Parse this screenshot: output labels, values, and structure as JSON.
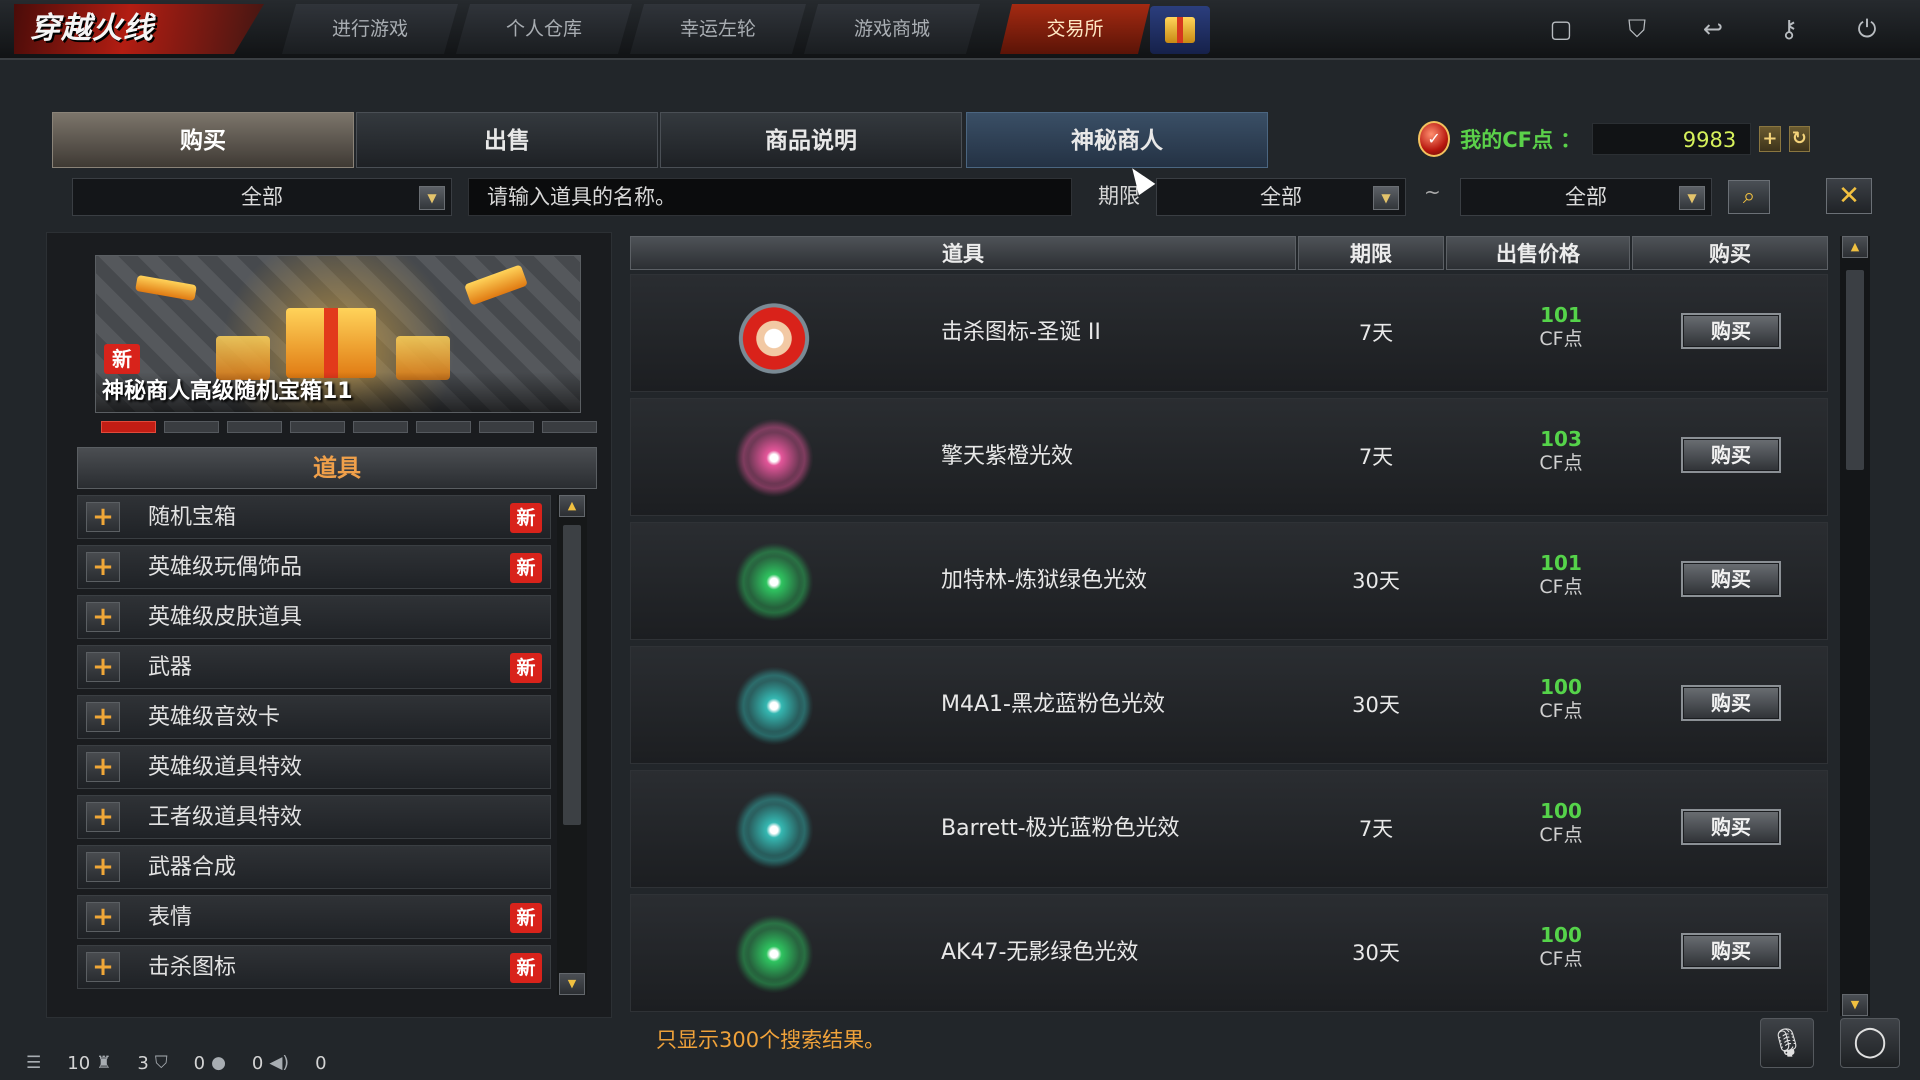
{
  "app": {
    "logo_text": "穿越火线"
  },
  "nav": {
    "items": [
      "进行游戏",
      "个人仓库",
      "幸运左轮",
      "游戏商城",
      "交易所"
    ],
    "active": "交易所",
    "icons": [
      "store-icon",
      "shield-icon",
      "return-icon",
      "key-icon",
      "power-icon"
    ]
  },
  "tabs": [
    "购买",
    "出售",
    "商品说明",
    "神秘商人"
  ],
  "cf": {
    "label": "我的CF点 ：",
    "value": "9983",
    "add": "+",
    "refresh": "↻"
  },
  "filters": {
    "category": "全部",
    "search_placeholder": "请输入道具的名称。",
    "period_label": "期限",
    "period_from": "全部",
    "tilde": "~",
    "period_to": "全部"
  },
  "banner": {
    "title": "神秘商人高级随机宝箱11",
    "new_badge": "新",
    "pages": 8,
    "active_page": 0
  },
  "left": {
    "header": "道具",
    "categories": [
      {
        "label": "随机宝箱",
        "new": "新"
      },
      {
        "label": "英雄级玩偶饰品",
        "new": "新"
      },
      {
        "label": "英雄级皮肤道具",
        "new": ""
      },
      {
        "label": "武器",
        "new": "新"
      },
      {
        "label": "英雄级音效卡",
        "new": ""
      },
      {
        "label": "英雄级道具特效",
        "new": ""
      },
      {
        "label": "王者级道具特效",
        "new": ""
      },
      {
        "label": "武器合成",
        "new": ""
      },
      {
        "label": "表情",
        "new": "新"
      },
      {
        "label": "击杀图标",
        "new": "新"
      }
    ]
  },
  "table": {
    "headers": [
      "道具",
      "期限",
      "出售价格",
      "购买"
    ],
    "rows": [
      {
        "name": "击杀图标-圣诞 II",
        "period": "7天",
        "price": "101",
        "unit": "CF点",
        "buy": "购买",
        "icon": "santa-icon"
      },
      {
        "name": "擎天紫橙光效",
        "period": "7天",
        "price": "103",
        "unit": "CF点",
        "buy": "购买",
        "icon": "purple-orange-glow-icon",
        "color": "#e4569a"
      },
      {
        "name": "加特林-炼狱绿色光效",
        "period": "30天",
        "price": "101",
        "unit": "CF点",
        "buy": "购买",
        "icon": "green-glow-icon",
        "color": "#2fc460"
      },
      {
        "name": "M4A1-黑龙蓝粉色光效",
        "period": "30天",
        "price": "100",
        "unit": "CF点",
        "buy": "购买",
        "icon": "blue-pink-glow-icon",
        "color": "#35b8b2"
      },
      {
        "name": "Barrett-极光蓝粉色光效",
        "period": "7天",
        "price": "100",
        "unit": "CF点",
        "buy": "购买",
        "icon": "blue-pink-glow-icon",
        "color": "#35b8b2"
      },
      {
        "name": "AK47-无影绿色光效",
        "period": "30天",
        "price": "100",
        "unit": "CF点",
        "buy": "购买",
        "icon": "green-glow-icon",
        "color": "#2fc460"
      }
    ]
  },
  "footer_note": "只显示300个搜索结果。",
  "status": {
    "players": "10",
    "shield": "3",
    "chat": "0",
    "sound": "0",
    "last": "0"
  }
}
